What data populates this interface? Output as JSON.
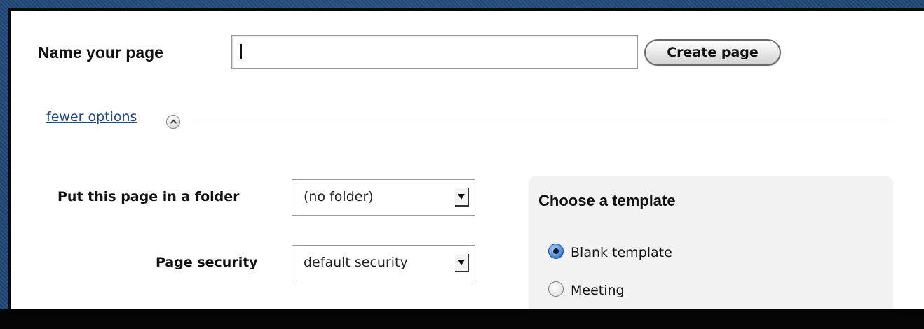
{
  "form": {
    "name_label": "Name your page",
    "name_value": "",
    "create_button": "Create page"
  },
  "options": {
    "toggle_label": "fewer options"
  },
  "folder": {
    "label": "Put this page in a folder",
    "selected": "(no folder)"
  },
  "security": {
    "label": "Page security",
    "selected": "default security"
  },
  "templates": {
    "title": "Choose a template",
    "items": [
      {
        "label": "Blank template",
        "checked": true
      },
      {
        "label": "Meeting",
        "checked": false
      }
    ]
  },
  "colors": {
    "link": "#1f4b86",
    "frame": "#2b5384",
    "radio_selected": "#3c7fd0"
  }
}
